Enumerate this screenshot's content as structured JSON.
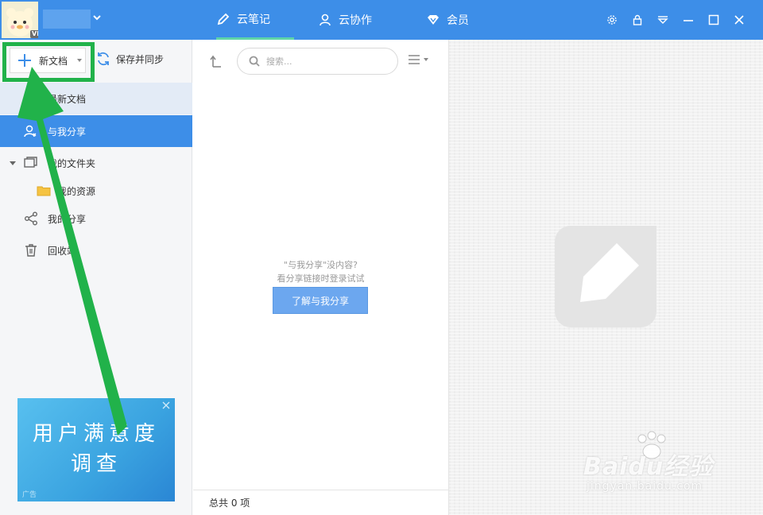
{
  "titlebar": {
    "vip": "VIP",
    "tabs": [
      {
        "label": "云笔记",
        "icon": "pencil-icon",
        "active": true
      },
      {
        "label": "云协作",
        "icon": "person-icon",
        "active": false
      },
      {
        "label": "会员",
        "icon": "diamond-icon",
        "active": false
      }
    ]
  },
  "toolbar": {
    "new_doc_label": "新文档",
    "save_sync_label": "保存并同步"
  },
  "sidebar": {
    "items": [
      {
        "label": "最新文档"
      },
      {
        "label": "与我分享"
      },
      {
        "label": "我的文件夹"
      },
      {
        "label": "我的资源"
      },
      {
        "label": "我的分享"
      },
      {
        "label": "回收站"
      }
    ]
  },
  "ad": {
    "title_line1": "用户满意度",
    "title_line2": "调查",
    "tag": "广告"
  },
  "middle": {
    "search_placeholder": "搜索...",
    "empty_line1": "\"与我分享\"没内容?",
    "empty_line2": "看分享链接时登录试试",
    "learn_button": "了解与我分享",
    "footer": "总共 0 项"
  },
  "watermark": {
    "brand": "Baidu经验",
    "url": "jingyan.baidu.com"
  },
  "colors": {
    "accent": "#3d8ee8",
    "highlight": "#21b24a",
    "tab_underline": "#5ed4a8"
  }
}
